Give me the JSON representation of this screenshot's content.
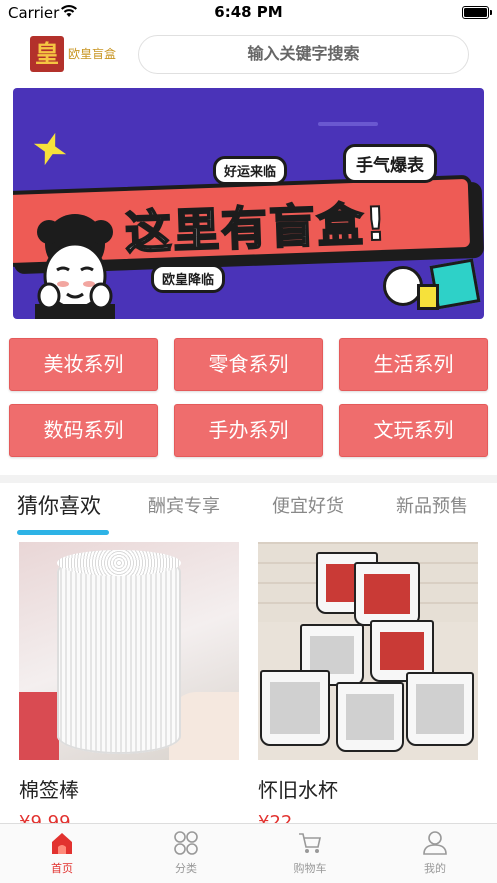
{
  "status_bar": {
    "carrier": "Carrier",
    "time": "6:48 PM"
  },
  "header": {
    "logo_mark": "皇",
    "logo_text": "欧皇盲盒",
    "search_placeholder": "输入关键字搜索"
  },
  "banner": {
    "headline": "这里有盲盒!",
    "tag_luck": "好运来临",
    "tag_hand": "手气爆表",
    "tag_ouhuang": "欧皇降临"
  },
  "categories": [
    {
      "label": "美妆系列"
    },
    {
      "label": "零食系列"
    },
    {
      "label": "生活系列"
    },
    {
      "label": "数码系列"
    },
    {
      "label": "手办系列"
    },
    {
      "label": "文玩系列"
    }
  ],
  "tabs": [
    {
      "label": "猜你喜欢",
      "active": true
    },
    {
      "label": "酬宾专享",
      "active": false
    },
    {
      "label": "便宜好货",
      "active": false
    },
    {
      "label": "新品预售",
      "active": false
    }
  ],
  "products": [
    {
      "name": "棉签棒",
      "price": "¥9.99"
    },
    {
      "name": "怀旧水杯",
      "price": "¥22"
    }
  ],
  "tabbar": [
    {
      "label": "首页",
      "icon": "home-icon",
      "active": true
    },
    {
      "label": "分类",
      "icon": "category-icon",
      "active": false
    },
    {
      "label": "购物车",
      "icon": "cart-icon",
      "active": false
    },
    {
      "label": "我的",
      "icon": "user-icon",
      "active": false
    }
  ],
  "colors": {
    "accent": "#e2322f",
    "category_bg": "#ef6d6d",
    "tab_underline": "#2eb3e6",
    "banner_bg": "#4a33b8"
  }
}
